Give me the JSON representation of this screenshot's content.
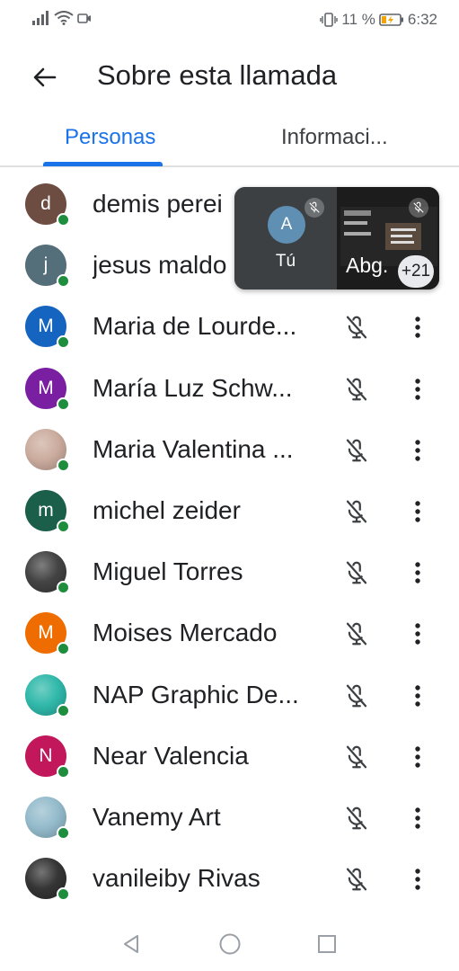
{
  "status_bar": {
    "battery_percent": "11 %",
    "time": "6:32"
  },
  "header": {
    "title": "Sobre esta llamada"
  },
  "tabs": [
    {
      "label": "Personas",
      "selected": true
    },
    {
      "label": "Informaci...",
      "selected": false
    }
  ],
  "overlay": {
    "self_initial": "A",
    "self_label": "Tú",
    "other_label": "Abg.",
    "more_count": "+21"
  },
  "participants": [
    {
      "initial": "d",
      "name": "demis perei",
      "avatar_color": "#6d4c41",
      "photo": false
    },
    {
      "initial": "j",
      "name": "jesus maldo",
      "avatar_color": "#546e7a",
      "photo": false
    },
    {
      "initial": "M",
      "name": "Maria de Lourde...",
      "avatar_color": "#1565c0",
      "photo": false
    },
    {
      "initial": "M",
      "name": "María Luz Schw...",
      "avatar_color": "#7b1fa2",
      "photo": false
    },
    {
      "initial": "",
      "name": "Maria Valentina ...",
      "avatar_color": "#c9a89a",
      "photo": true
    },
    {
      "initial": "m",
      "name": "michel zeider",
      "avatar_color": "#1b5e4a",
      "photo": false
    },
    {
      "initial": "",
      "name": "Miguel Torres",
      "avatar_color": "#3a3a3a",
      "photo": true
    },
    {
      "initial": "M",
      "name": "Moises Mercado",
      "avatar_color": "#ef6c00",
      "photo": false
    },
    {
      "initial": "",
      "name": "NAP Graphic De...",
      "avatar_color": "#26b5a6",
      "photo": true
    },
    {
      "initial": "N",
      "name": "Near Valencia",
      "avatar_color": "#c2185b",
      "photo": false
    },
    {
      "initial": "",
      "name": "Vanemy Art",
      "avatar_color": "#8fb8c9",
      "photo": true
    },
    {
      "initial": "",
      "name": "vanileiby Rivas",
      "avatar_color": "#2b2b2b",
      "photo": true
    }
  ],
  "colors": {
    "accent": "#1a73e8",
    "presence": "#1e8e3e",
    "text": "#202124"
  }
}
